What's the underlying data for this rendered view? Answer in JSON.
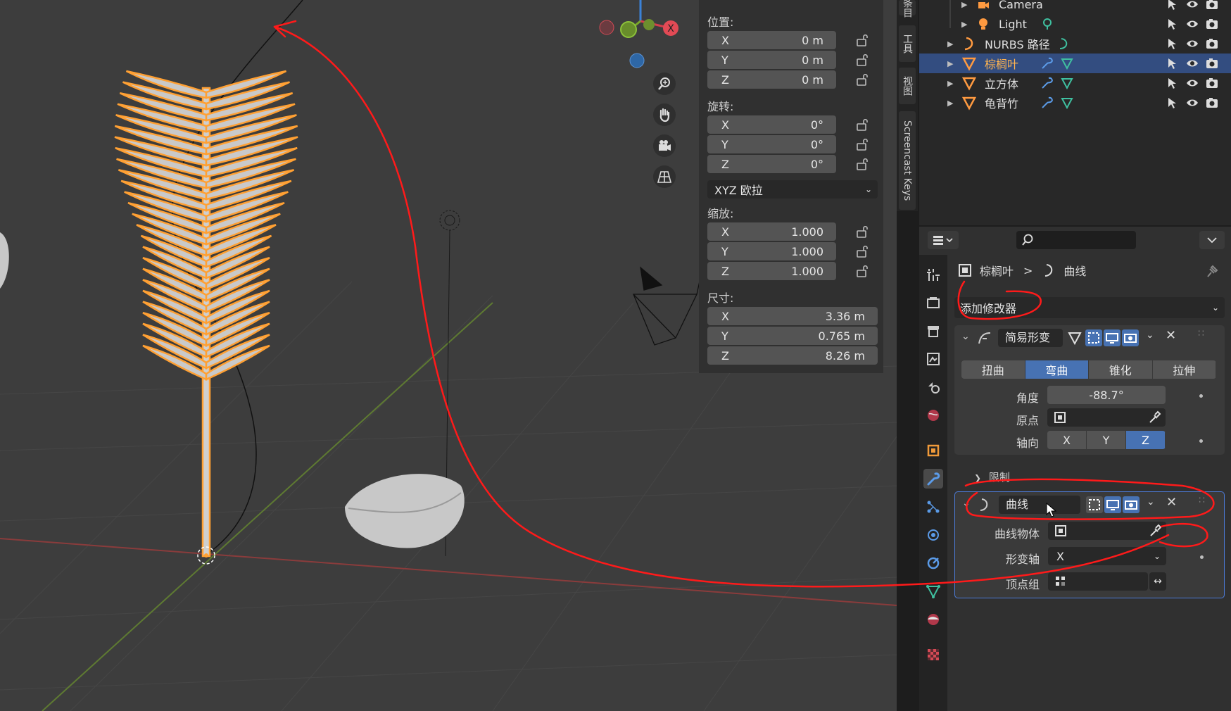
{
  "npanel": {
    "location_label": "位置:",
    "location": [
      {
        "axis": "X",
        "value": "0 m"
      },
      {
        "axis": "Y",
        "value": "0 m"
      },
      {
        "axis": "Z",
        "value": "0 m"
      }
    ],
    "rotation_label": "旋转:",
    "rotation": [
      {
        "axis": "X",
        "value": "0°"
      },
      {
        "axis": "Y",
        "value": "0°"
      },
      {
        "axis": "Z",
        "value": "0°"
      }
    ],
    "rotation_mode": "XYZ 欧拉",
    "scale_label": "缩放:",
    "scale": [
      {
        "axis": "X",
        "value": "1.000"
      },
      {
        "axis": "Y",
        "value": "1.000"
      },
      {
        "axis": "Z",
        "value": "1.000"
      }
    ],
    "dimensions_label": "尺寸:",
    "dimensions": [
      {
        "axis": "X",
        "value": "3.36 m"
      },
      {
        "axis": "Y",
        "value": "0.765 m"
      },
      {
        "axis": "Z",
        "value": "8.26 m"
      }
    ]
  },
  "vtabs": [
    "条目",
    "工具",
    "视图",
    "Screencast Keys"
  ],
  "gizmo": {
    "x": "X"
  },
  "outliner": [
    {
      "label": "Camera",
      "icon": "camera-icon"
    },
    {
      "label": "Light",
      "icon": "light-icon"
    },
    {
      "label": "NURBS 路径",
      "icon": "curve-icon"
    },
    {
      "label": "棕榈叶",
      "icon": "mesh-icon",
      "selected": true
    },
    {
      "label": "立方体",
      "icon": "mesh-icon"
    },
    {
      "label": "龟背竹",
      "icon": "mesh-icon"
    }
  ],
  "properties": {
    "breadcrumb_object": "棕榈叶",
    "breadcrumb_separator": ">",
    "breadcrumb_modifier": "曲线",
    "add_modifier": "添加修改器",
    "simple_deform": {
      "name": "简易形变",
      "modes": [
        "扭曲",
        "弯曲",
        "锥化",
        "拉伸"
      ],
      "active_mode": "弯曲",
      "angle_label": "角度",
      "angle_value": "-88.7°",
      "origin_label": "原点",
      "axis_label": "轴向",
      "axes": [
        "X",
        "Y",
        "Z"
      ],
      "active_axis": "Z",
      "limits_label": "限制"
    },
    "curve": {
      "name": "曲线",
      "curve_object_label": "曲线物体",
      "deform_axis_label": "形变轴",
      "deform_axis_value": "X",
      "vertex_group_label": "顶点组"
    }
  },
  "colors": {
    "accent": "#4772b3",
    "selection": "#ffa033",
    "annotation": "#ff1a1a"
  }
}
